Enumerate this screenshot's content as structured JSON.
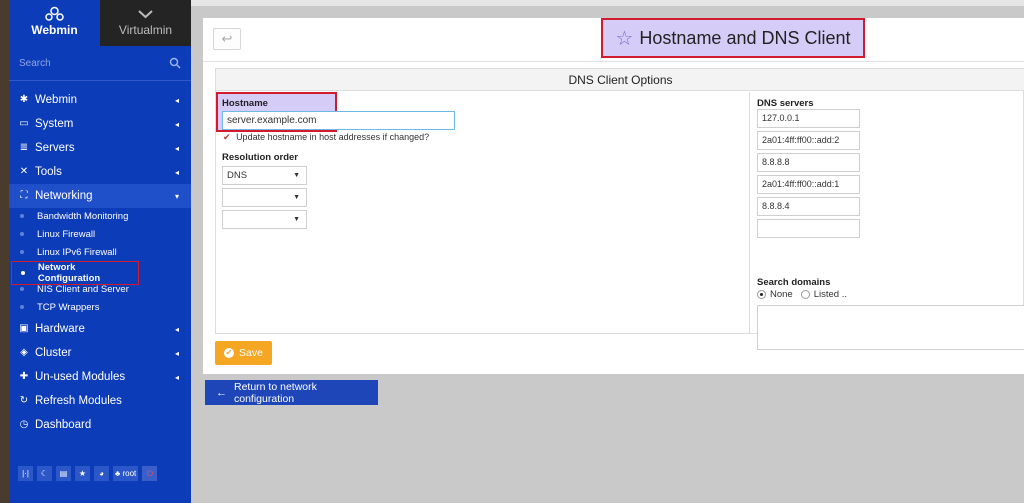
{
  "sidebar": {
    "tabs": [
      {
        "label": "Webmin"
      },
      {
        "label": "Virtualmin"
      }
    ],
    "search_placeholder": "Search",
    "menu": [
      {
        "label": "Webmin",
        "icon": "gear-icon"
      },
      {
        "label": "System",
        "icon": "monitor-icon"
      },
      {
        "label": "Servers",
        "icon": "server-icon"
      },
      {
        "label": "Tools",
        "icon": "tools-icon"
      },
      {
        "label": "Networking",
        "icon": "network-icon"
      }
    ],
    "submenu": [
      {
        "label": "Bandwidth Monitoring"
      },
      {
        "label": "Linux Firewall"
      },
      {
        "label": "Linux IPv6 Firewall"
      },
      {
        "label": "Network Configuration"
      },
      {
        "label": "NIS Client and Server"
      },
      {
        "label": "TCP Wrappers"
      }
    ],
    "menu_after": [
      {
        "label": "Hardware",
        "icon": "hardware-icon"
      },
      {
        "label": "Cluster",
        "icon": "cluster-icon"
      },
      {
        "label": "Un-used Modules",
        "icon": "puzzle-icon"
      },
      {
        "label": "Refresh Modules",
        "icon": "refresh-icon"
      },
      {
        "label": "Dashboard",
        "icon": "dashboard-icon"
      }
    ],
    "bottom_user": "root"
  },
  "page": {
    "title": "Hostname and DNS Client",
    "section_title": "DNS Client Options",
    "hostname_label": "Hostname",
    "hostname_value": "server.example.com",
    "update_hostname_label": "Update hostname in host addresses if changed?",
    "resolution_label": "Resolution order",
    "resolution": [
      "DNS",
      "",
      ""
    ],
    "dns_servers_label": "DNS servers",
    "dns_servers": [
      "127.0.0.1",
      "2a01:4ff:ff00::add:2",
      "8.8.8.8",
      "2a01:4ff:ff00::add:1",
      "8.8.8.4",
      ""
    ],
    "search_domains_label": "Search domains",
    "search_none_label": "None",
    "search_listed_label": "Listed ..",
    "save_label": "Save",
    "return_label": "Return to network configuration"
  },
  "colors": {
    "sidebar_bg": "#0d3cb8",
    "accent_save": "#f5a623",
    "highlight_border": "#d21b2c"
  }
}
